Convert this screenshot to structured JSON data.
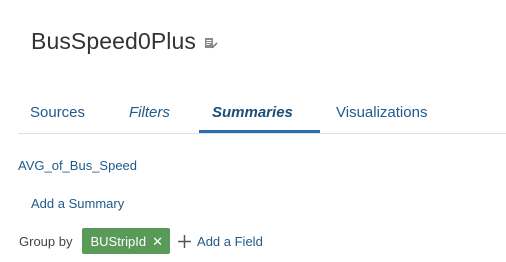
{
  "header": {
    "title": "BusSpeed0Plus",
    "edit_icon": "edit-pencil-icon"
  },
  "tabs": [
    {
      "label": "Sources",
      "active": false
    },
    {
      "label": "Filters",
      "active": false
    },
    {
      "label": "Summaries",
      "active": true
    },
    {
      "label": "Visualizations",
      "active": false
    }
  ],
  "summaries": {
    "items": [
      {
        "label": "AVG_of_Bus_Speed"
      }
    ],
    "add_label": "Add a Summary"
  },
  "group_by": {
    "label": "Group by",
    "fields": [
      {
        "label": "BUStripId",
        "remove_icon": "close-x-icon"
      }
    ],
    "add_field_label": "Add a Field",
    "add_icon": "plus-icon"
  },
  "colors": {
    "link": "#1f5a8c",
    "active_tab_underline": "#2a6db5",
    "chip_bg": "#5a9a58"
  }
}
